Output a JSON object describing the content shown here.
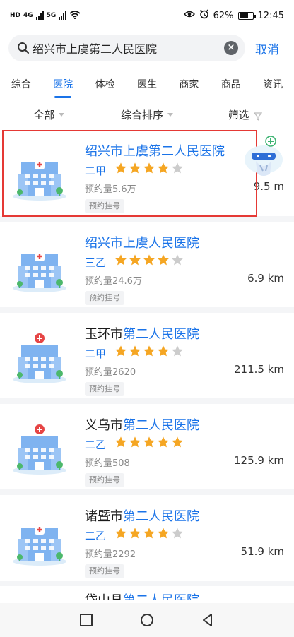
{
  "status": {
    "network_left": "HD",
    "network_second": "HD",
    "net_type_1": "4G",
    "net_type_2": "5G",
    "battery_percent": "62%",
    "time": "12:45"
  },
  "search": {
    "value": "绍兴市上虞第二人民医院",
    "cancel_label": "取消"
  },
  "tabs": [
    {
      "label": "综合",
      "active": false
    },
    {
      "label": "医院",
      "active": true
    },
    {
      "label": "体检",
      "active": false
    },
    {
      "label": "医生",
      "active": false
    },
    {
      "label": "商家",
      "active": false
    },
    {
      "label": "商品",
      "active": false
    },
    {
      "label": "资讯",
      "active": false
    }
  ],
  "filters": {
    "all": "全部",
    "sort": "综合排序",
    "filter": "筛选"
  },
  "hospitals": [
    {
      "name_prefix": "",
      "name_highlight": "绍兴市上虞第二人民医院",
      "level": "二甲",
      "rating": 4,
      "count": "预约量5.6万",
      "tag": "预约挂号",
      "distance": "9.5 m"
    },
    {
      "name_prefix": "",
      "name_highlight": "绍兴市上虞人民医院",
      "level": "三乙",
      "rating": 4,
      "count": "预约量24.6万",
      "tag": "预约挂号",
      "distance": "6.9 km"
    },
    {
      "name_prefix": "玉环市",
      "name_highlight": "第二人民医院",
      "level": "二甲",
      "rating": 4,
      "count": "预约量2620",
      "tag": "预约挂号",
      "distance": "211.5 km"
    },
    {
      "name_prefix": "义乌市",
      "name_highlight": "第二人民医院",
      "level": "二乙",
      "rating": 5,
      "count": "预约量508",
      "tag": "预约挂号",
      "distance": "125.9 km"
    },
    {
      "name_prefix": "诸暨市",
      "name_highlight": "第二人民医院",
      "level": "二乙",
      "rating": 4,
      "count": "预约量2292",
      "tag": "预约挂号",
      "distance": "51.9 km"
    }
  ],
  "partial_item": {
    "name_prefix": "岱山县",
    "name_highlight": "第二人民医院"
  },
  "colors": {
    "accent": "#1a73e8",
    "star": "#f5a623",
    "star_empty": "#cccccc",
    "highlight_box": "#e53935"
  }
}
